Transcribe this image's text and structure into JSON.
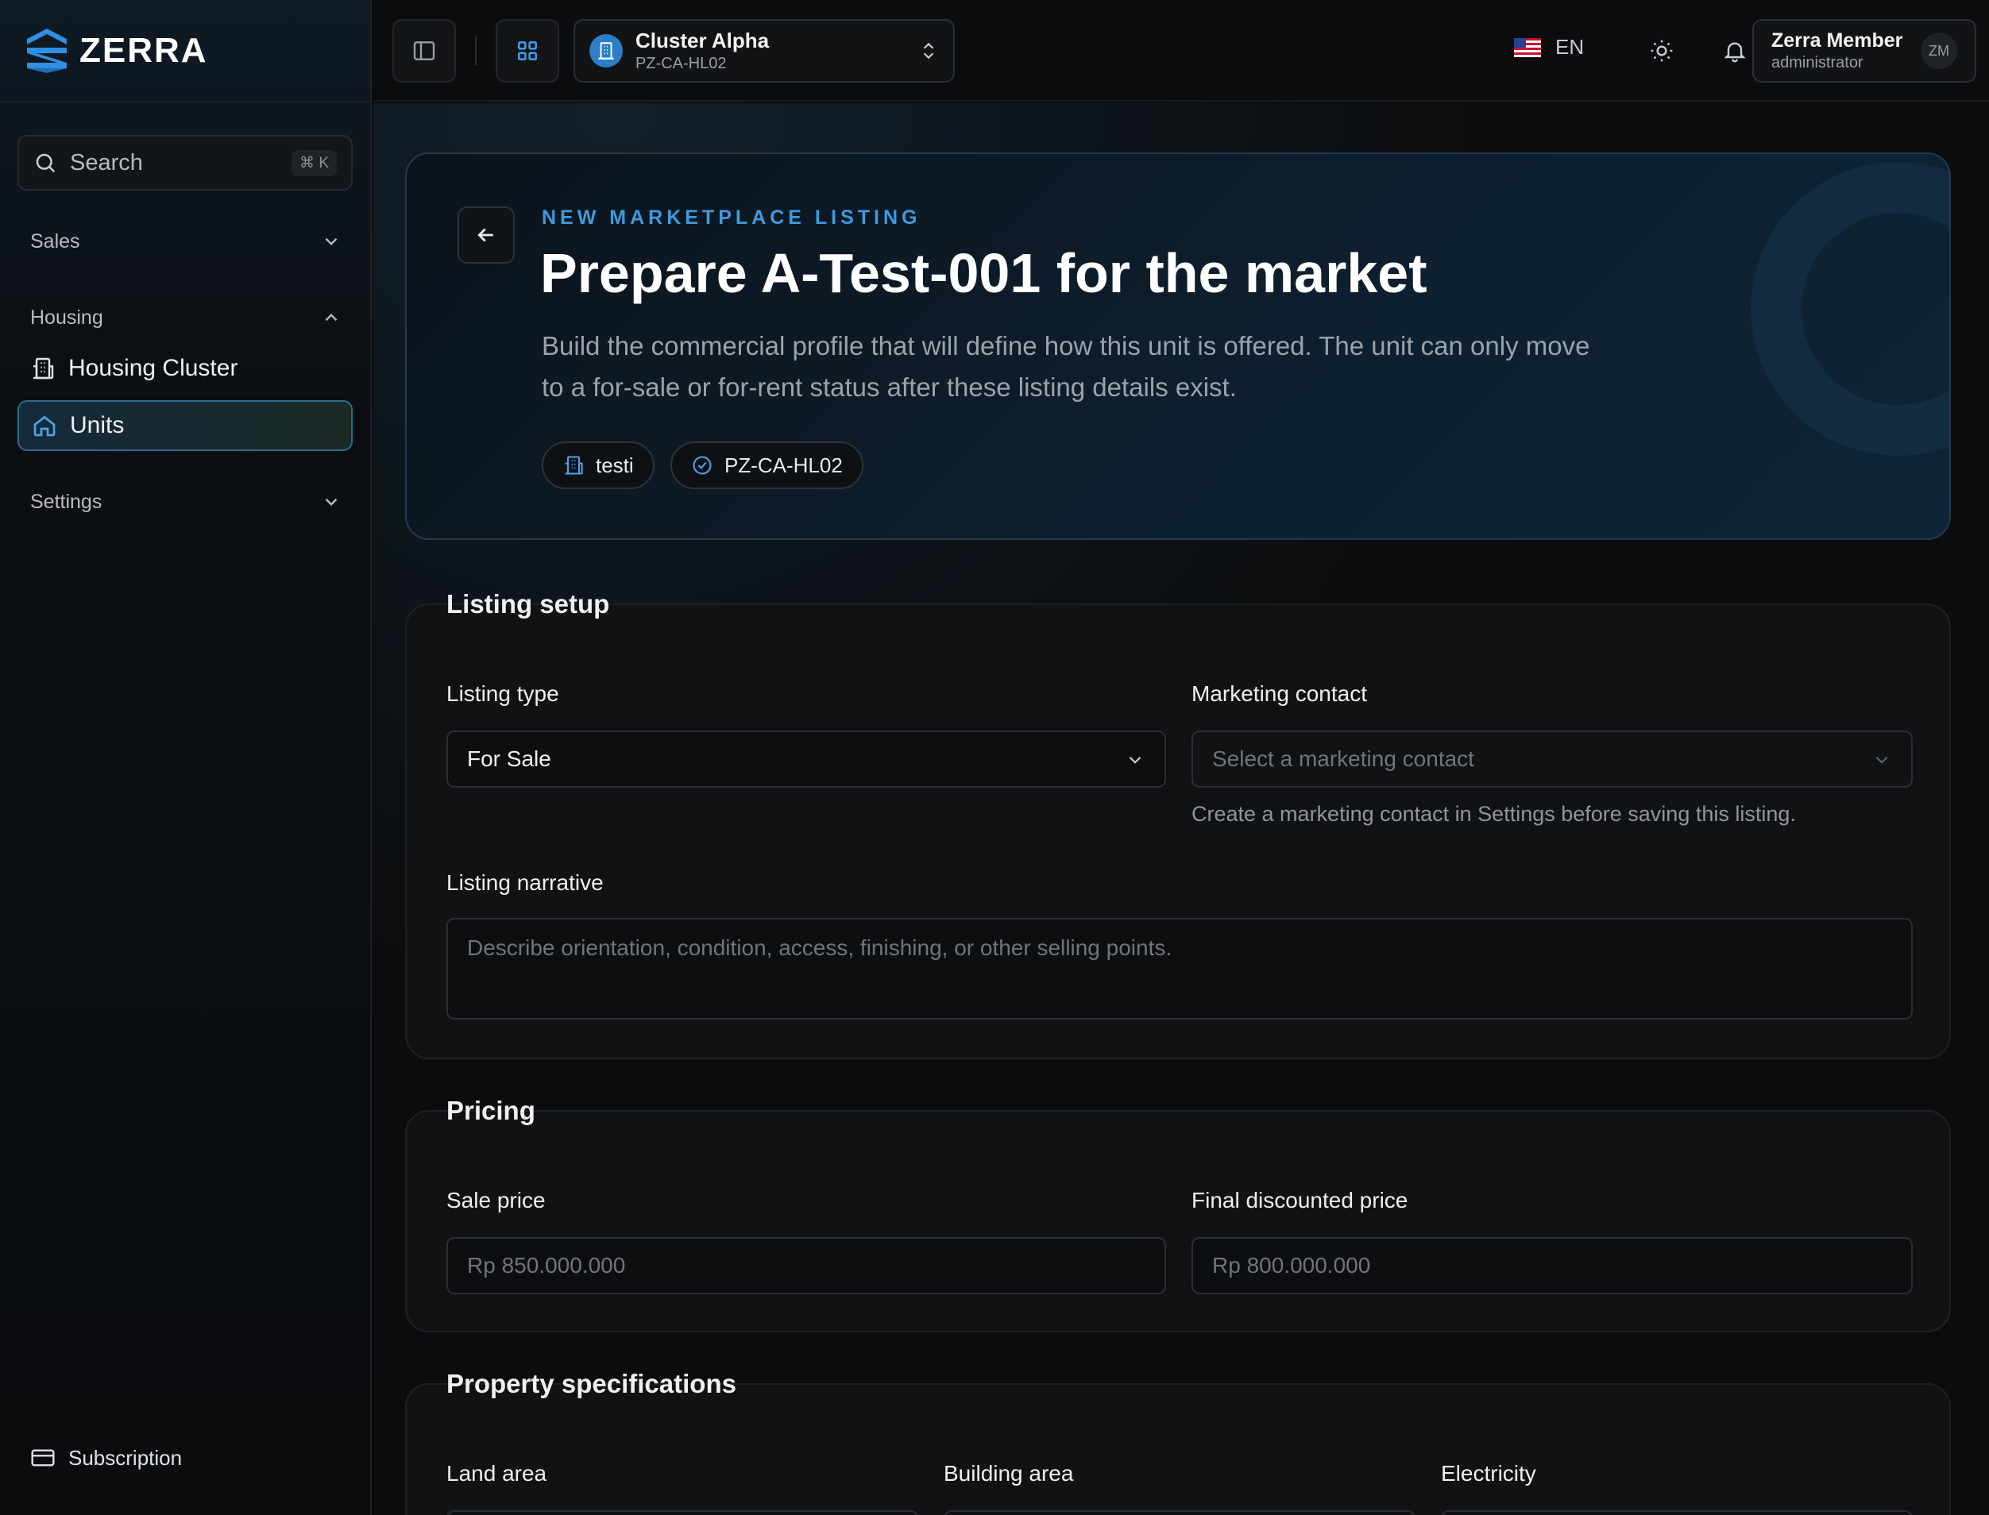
{
  "brand": {
    "name": "ZERRA"
  },
  "search": {
    "label": "Search",
    "shortcut": "⌘ K"
  },
  "sidebar": {
    "sections": [
      {
        "label": "Sales",
        "state": "collapsed"
      },
      {
        "label": "Housing",
        "state": "expanded"
      },
      {
        "label": "Settings",
        "state": "collapsed"
      }
    ],
    "items": [
      {
        "label": "Housing Cluster",
        "icon": "building-icon",
        "active": false
      },
      {
        "label": "Units",
        "icon": "home-icon",
        "active": true
      }
    ],
    "footer": {
      "label": "Subscription",
      "icon": "credit-card-icon"
    }
  },
  "topbar": {
    "cluster": {
      "name": "Cluster Alpha",
      "code": "PZ-CA-HL02"
    },
    "language": "EN",
    "user": {
      "name": "Zerra Member",
      "role": "administrator",
      "initials": "ZM"
    }
  },
  "hero": {
    "eyebrow": "NEW MARKETPLACE LISTING",
    "title": "Prepare A-Test-001 for the market",
    "description": "Build the commercial profile that will define how this unit is offered. The unit can only move to a for-sale or for-rent status after these listing details exist.",
    "chips": [
      {
        "label": "testi",
        "icon": "building-icon"
      },
      {
        "label": "PZ-CA-HL02",
        "icon": "check-badge-icon"
      }
    ]
  },
  "listing_setup": {
    "title": "Listing setup",
    "listing_type": {
      "label": "Listing type",
      "value": "For Sale"
    },
    "marketing_contact": {
      "label": "Marketing contact",
      "placeholder": "Select a marketing contact",
      "hint": "Create a marketing contact in Settings before saving this listing."
    },
    "narrative": {
      "label": "Listing narrative",
      "placeholder": "Describe orientation, condition, access, finishing, or other selling points."
    }
  },
  "pricing": {
    "title": "Pricing",
    "sale_price": {
      "label": "Sale price",
      "placeholder": "Rp 850.000.000"
    },
    "final_price": {
      "label": "Final discounted price",
      "placeholder": "Rp 800.000.000"
    }
  },
  "specs": {
    "title": "Property specifications",
    "land_area": {
      "label": "Land area"
    },
    "building_area": {
      "label": "Building area"
    },
    "electricity": {
      "label": "Electricity"
    }
  },
  "colors": {
    "accent": "#3f9ae0",
    "active_border": "#2f6a8e",
    "background": "#0b0c0d"
  }
}
